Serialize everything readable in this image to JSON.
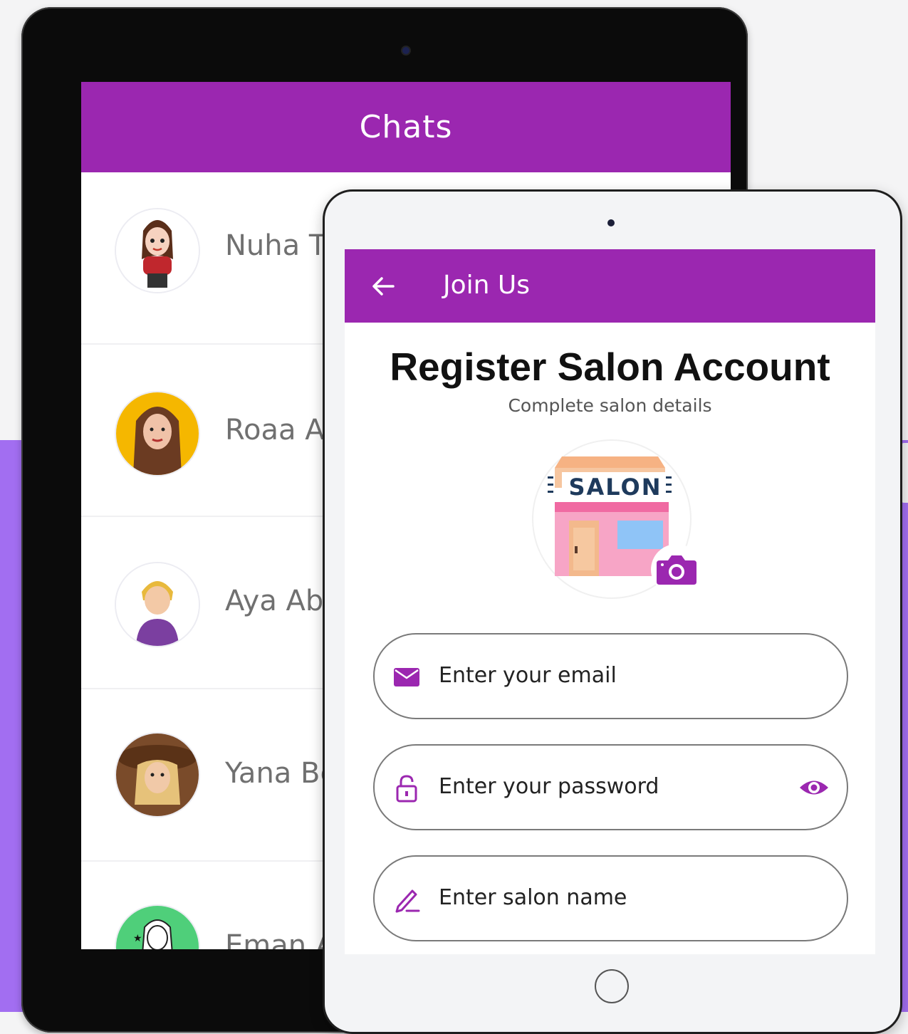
{
  "chats_screen": {
    "title": "Chats",
    "contacts": [
      {
        "name": "Nuha Ta"
      },
      {
        "name": "Roaa Ah"
      },
      {
        "name": "Aya Abu"
      },
      {
        "name": "Yana Be"
      },
      {
        "name": "Eman Al"
      }
    ]
  },
  "register_screen": {
    "header_title": "Join Us",
    "page_title": "Register Salon Account",
    "subtitle": "Complete salon details",
    "salon_sign": "SALON",
    "fields": {
      "email": {
        "placeholder": "Enter your email"
      },
      "password": {
        "placeholder": "Enter your password"
      },
      "salon_name": {
        "placeholder": "Enter salon name"
      }
    }
  },
  "colors": {
    "primary": "#9b27b0",
    "background_band": "#a26ef1"
  }
}
